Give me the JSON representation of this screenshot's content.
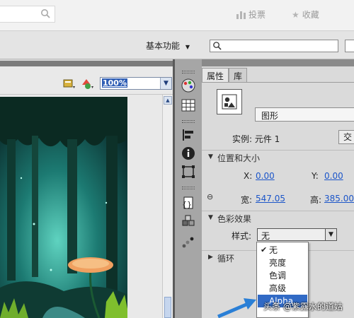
{
  "topbar": {
    "nav_items": [
      {
        "label": "投票",
        "icon": "chart-icon"
      },
      {
        "label": "收藏",
        "icon": "star-icon"
      }
    ]
  },
  "app": {
    "workspace_label": "基本功能",
    "search_value": ""
  },
  "stage": {
    "zoom_value": "100%"
  },
  "panel": {
    "tabs": [
      "属性",
      "库"
    ],
    "active_tab": "属性",
    "instance_type": "图形",
    "instance_label": "实例: 元件 1",
    "swap_label": "交",
    "position_size": {
      "title": "位置和大小",
      "x_label": "X:",
      "x_value": "0.00",
      "y_label": "Y:",
      "y_value": "0.00",
      "w_label": "宽:",
      "w_value": "547.05",
      "h_label": "高:",
      "h_value": "385.00"
    },
    "color_effect": {
      "title": "色彩效果",
      "style_label": "样式:",
      "style_value": "无",
      "options": [
        "无",
        "亮度",
        "色调",
        "高级",
        "Alpha"
      ],
      "checked": "无",
      "highlighted": "Alpha"
    },
    "loop_title": "循环"
  },
  "watermark": "头条 @紫露水的道姑",
  "colors": {
    "accent": "#316ac5",
    "link": "#1b55c9",
    "arrow": "#2a7fd6"
  }
}
